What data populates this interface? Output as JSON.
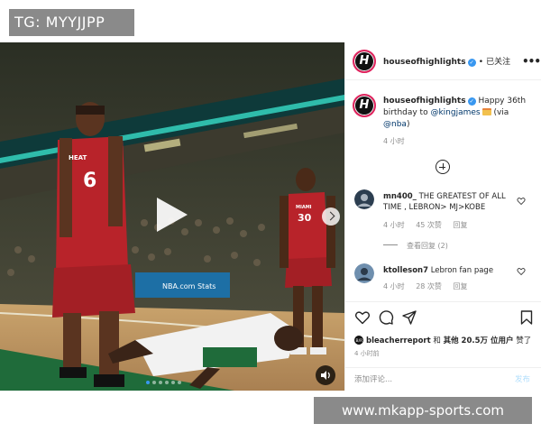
{
  "watermark_top": "TG: MYYJJPP",
  "watermark_bottom": "www.mkapp-sports.com",
  "colors": {
    "verified": "#3897f0",
    "mention": "#00376b",
    "muted": "#8e8e8e",
    "post_disabled": "#b2dffc",
    "avatar_ring": "#e0245e"
  },
  "header": {
    "username": "houseofhighlights",
    "follow_label": "已关注",
    "separator": "•",
    "more_icon": "more-horizontal-icon",
    "avatar_letter": "H"
  },
  "caption": {
    "username": "houseofhighlights",
    "text_before": "Happy 36th birthday to ",
    "mention_user": "@kingjames",
    "emoji": "birthday-cake-emoji",
    "text_via": " (via ",
    "mention_source": "@nba",
    "text_end": ")",
    "time": "4 小时"
  },
  "comments": [
    {
      "username": "mn400_",
      "text": "THE GREATEST OF ALL TIME , LEBRON> MJ>KOBE",
      "time": "4 小时",
      "likes": "45 次赞",
      "reply": "回复",
      "view_replies": "查看回复 (2)"
    },
    {
      "username": "ktolleson7",
      "text": "Lebron fan page",
      "time": "4 小时",
      "likes": "28 次赞",
      "reply": "回复"
    }
  ],
  "actions": {
    "icons": [
      "heart-icon",
      "comment-icon",
      "share-icon",
      "bookmark-icon"
    ],
    "likes_prefix_user": "bleacherreport",
    "likes_mid": " 和 ",
    "likes_others": "其他 20.5万 位用户",
    "likes_suffix": " 赞了",
    "post_time": "4 小时前"
  },
  "comment_box": {
    "placeholder": "添加评论...",
    "post_label": "发布"
  },
  "media": {
    "jersey_numbers": [
      "6",
      "30"
    ],
    "jersey_text": [
      "HEAT",
      "MIAMI"
    ],
    "board_text": "NBA.com Stats",
    "carousel_dots": 6,
    "active_dot": 0
  }
}
